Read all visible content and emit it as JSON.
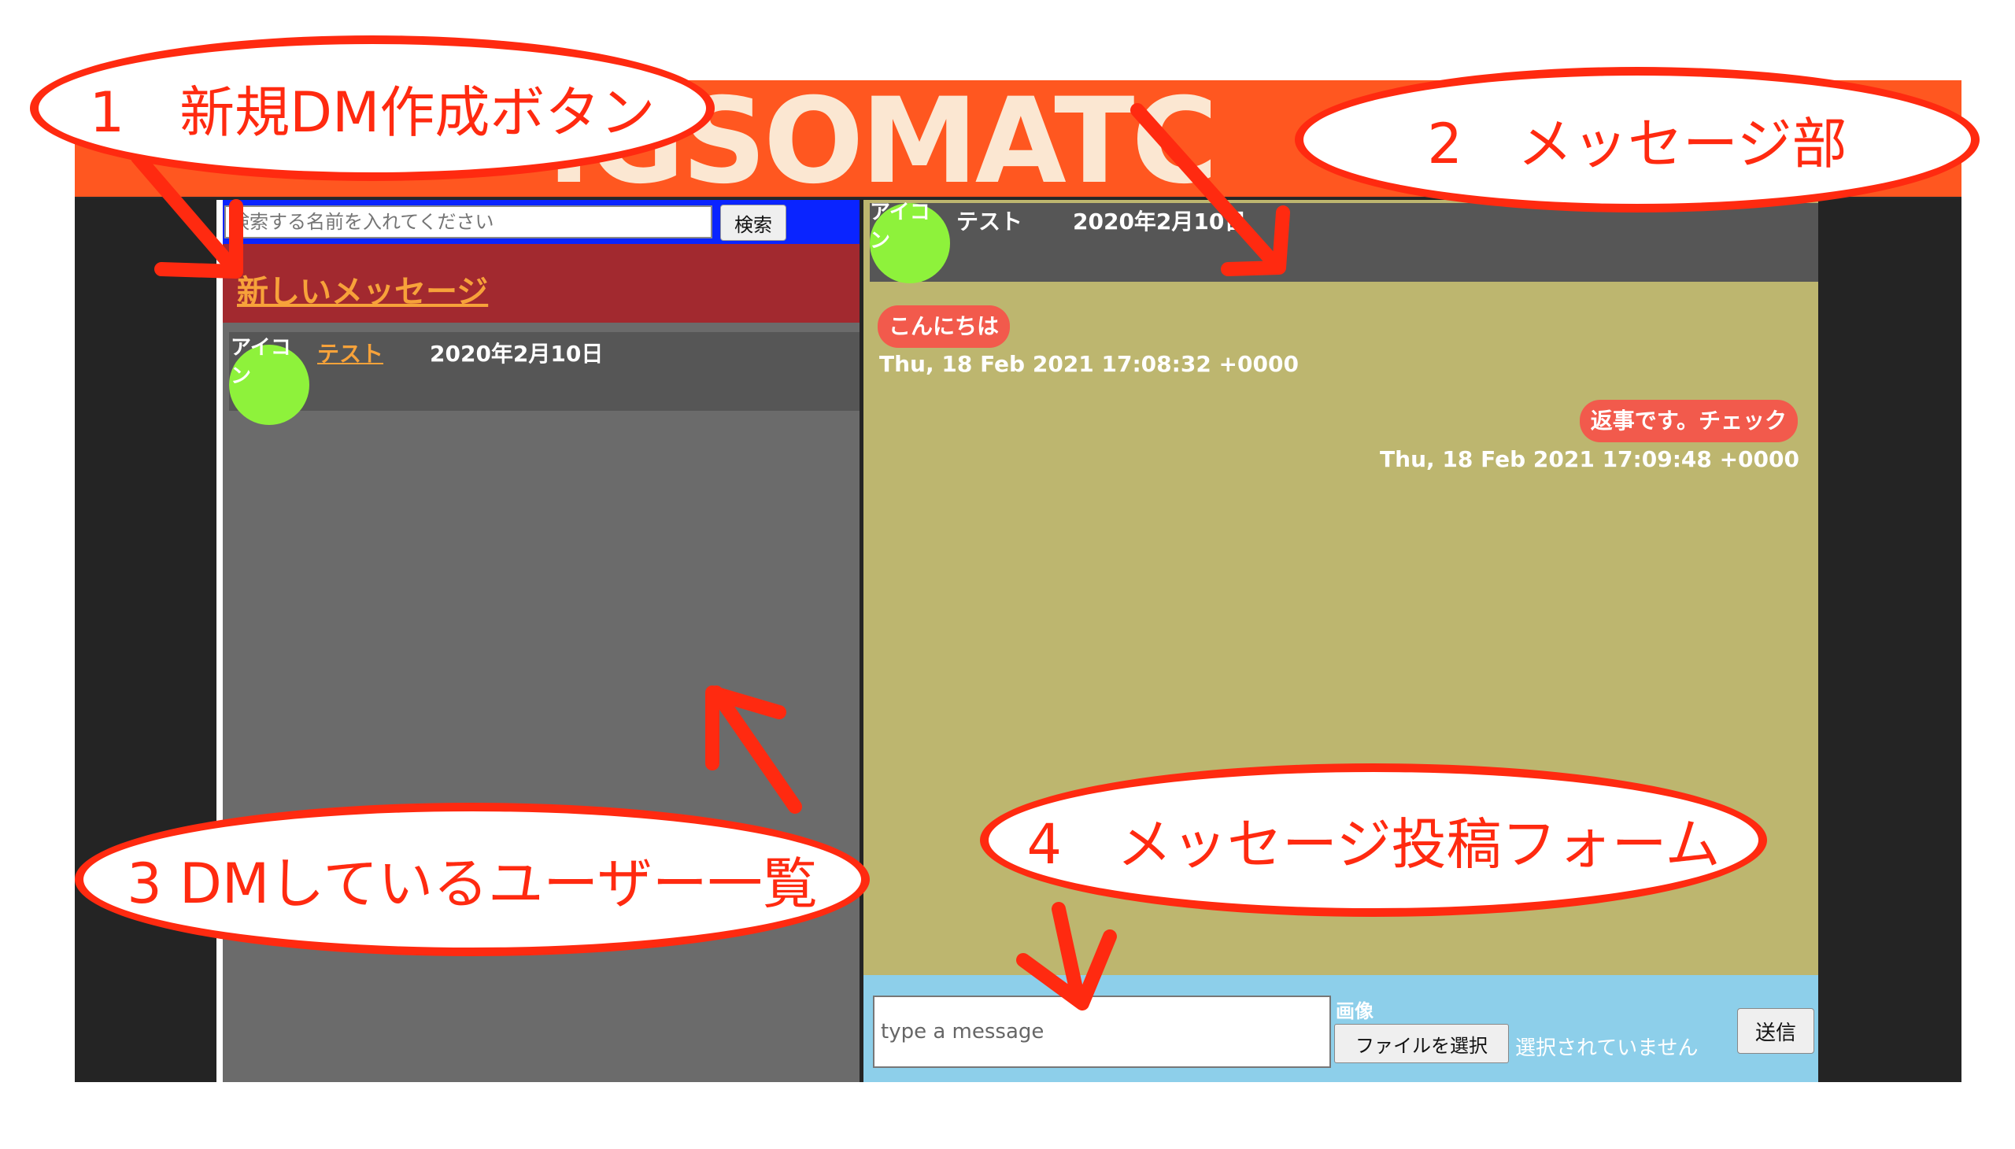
{
  "app": {
    "banner_title": "IGSOMATC"
  },
  "sidebar": {
    "search_placeholder": "検索する名前を入れてください",
    "search_button": "検索",
    "new_message_link": "新しいメッセージ",
    "users": [
      {
        "avatar_text": "アイコン",
        "name": "テスト",
        "date": "2020年2月10日"
      }
    ]
  },
  "chat": {
    "header": {
      "avatar_text": "アイコン",
      "name": "テスト",
      "date": "2020年2月10日"
    },
    "messages": [
      {
        "text": "こんにちは",
        "time": "Thu, 18 Feb 2021 17:08:32 +0000",
        "side": "left"
      },
      {
        "text": "返事です。チェック",
        "time": "Thu, 18 Feb 2021 17:09:48 +0000",
        "side": "right"
      }
    ],
    "composer": {
      "placeholder": "type a message",
      "image_label": "画像",
      "file_button": "ファイルを選択",
      "file_status": "選択されていません",
      "send_button": "送信"
    }
  },
  "annotations": [
    {
      "number": "1",
      "label": "新規DM作成ボタン"
    },
    {
      "number": "2",
      "label": "メッセージ部"
    },
    {
      "number": "3",
      "label": "DMしているユーザー一覧"
    },
    {
      "number": "4",
      "label": "メッセージ投稿フォーム"
    }
  ],
  "colors": {
    "annotation_red": "#ff2a10",
    "banner_orange": "#ff5720",
    "sidebar_gray": "#6b6b6b",
    "chat_olive": "#bdb66f",
    "bubble_red": "#f25a4c",
    "avatar_green": "#8ef23b",
    "link_orange": "#f7a23a",
    "composer_blue": "#8dcfea"
  }
}
